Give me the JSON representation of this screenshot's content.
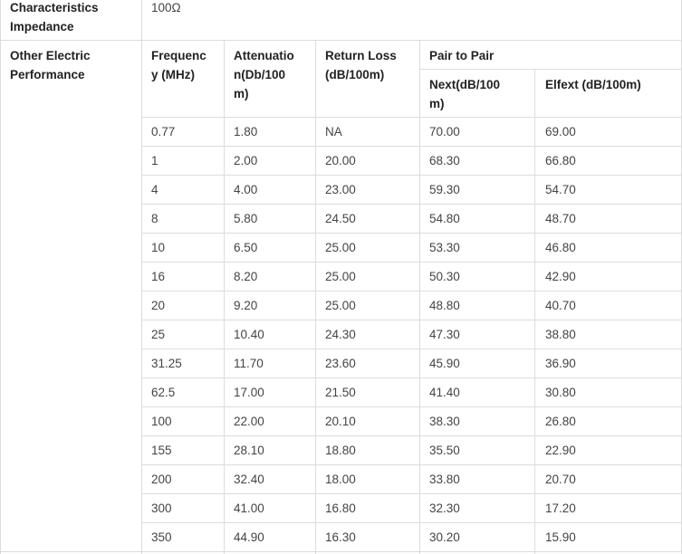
{
  "table": {
    "impedance": {
      "label": "Characteristics Impedance",
      "label_lines": [
        "Characteristics",
        "Impedance"
      ],
      "value": "100Ω"
    },
    "performance_label": "Other Electric Performance",
    "performance_label_lines": [
      "Other Electric",
      "Performance"
    ],
    "headers": {
      "frequency_lines": [
        "Frequenc",
        "y (MHz)"
      ],
      "attenuation_lines": [
        "Attenuatio",
        "n(Db/100",
        "m)"
      ],
      "return_loss_lines": [
        "Return Loss",
        "(dB/100m)"
      ],
      "pair_to_pair": "Pair to Pair",
      "next_lines": [
        "Next(dB/100",
        "m)"
      ],
      "elfext": "Elfext (dB/100m)"
    },
    "rows": [
      [
        "0.77",
        "1.80",
        "NA",
        "70.00",
        "69.00"
      ],
      [
        "1",
        "2.00",
        "20.00",
        "68.30",
        "66.80"
      ],
      [
        "4",
        "4.00",
        "23.00",
        "59.30",
        "54.70"
      ],
      [
        "8",
        "5.80",
        "24.50",
        "54.80",
        "48.70"
      ],
      [
        "10",
        "6.50",
        "25.00",
        "53.30",
        "46.80"
      ],
      [
        "16",
        "8.20",
        "25.00",
        "50.30",
        "42.90"
      ],
      [
        "20",
        "9.20",
        "25.00",
        "48.80",
        "40.70"
      ],
      [
        "25",
        "10.40",
        "24.30",
        "47.30",
        "38.80"
      ],
      [
        "31.25",
        "11.70",
        "23.60",
        "45.90",
        "36.90"
      ],
      [
        "62.5",
        "17.00",
        "21.50",
        "41.40",
        "30.80"
      ],
      [
        "100",
        "22.00",
        "20.10",
        "38.30",
        "26.80"
      ],
      [
        "155",
        "28.10",
        "18.80",
        "35.50",
        "22.90"
      ],
      [
        "200",
        "32.40",
        "18.00",
        "33.80",
        "20.70"
      ],
      [
        "300",
        "41.00",
        "16.80",
        "32.30",
        "17.20"
      ],
      [
        "350",
        "44.90",
        "16.30",
        "30.20",
        "15.90"
      ]
    ]
  }
}
